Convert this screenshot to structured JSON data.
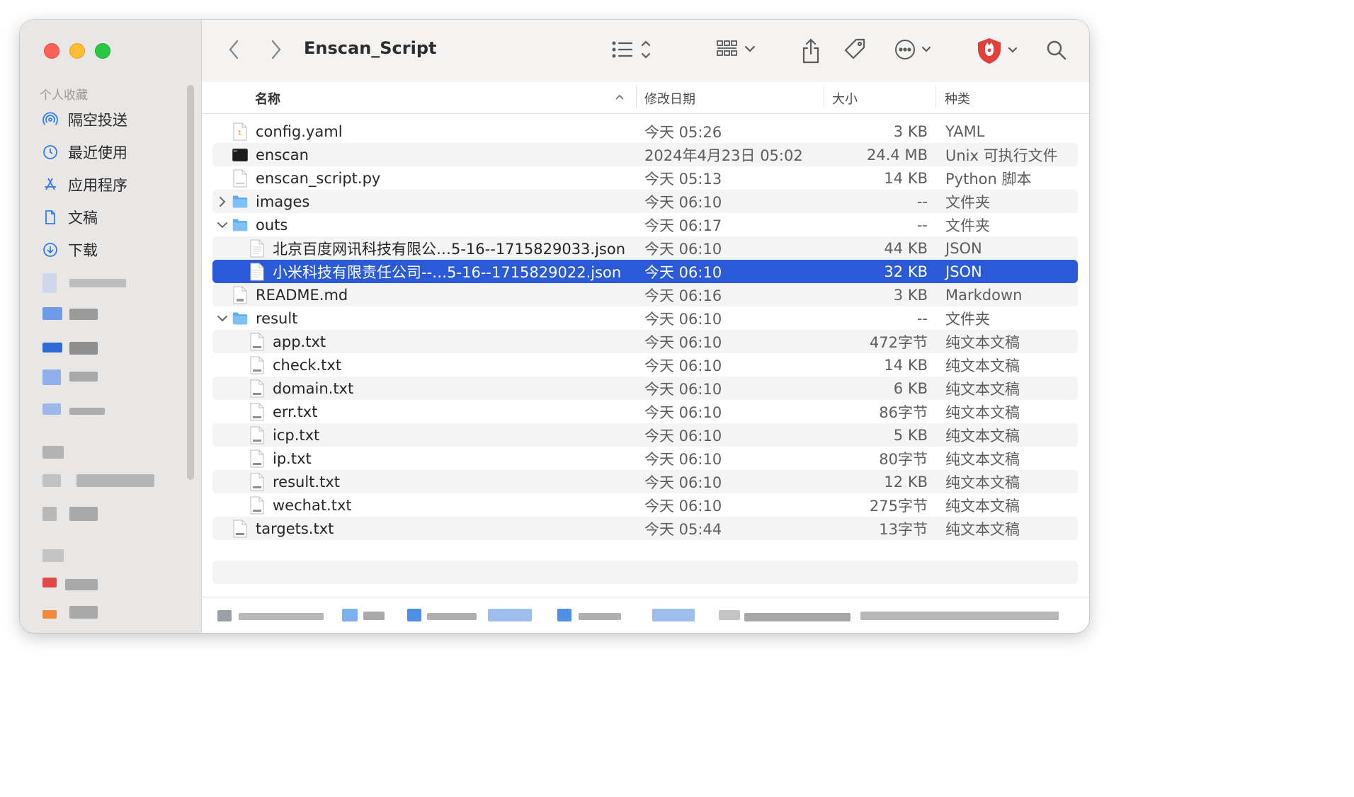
{
  "window": {
    "title": "Enscan_Script"
  },
  "sidebar": {
    "section_label": "个人收藏",
    "items": [
      {
        "label": "隔空投送",
        "icon": "airdrop-icon"
      },
      {
        "label": "最近使用",
        "icon": "clock-icon"
      },
      {
        "label": "应用程序",
        "icon": "applications-icon"
      },
      {
        "label": "文稿",
        "icon": "document-icon"
      },
      {
        "label": "下载",
        "icon": "download-icon"
      }
    ]
  },
  "columns": {
    "name": "名称",
    "date": "修改日期",
    "size": "大小",
    "kind": "种类"
  },
  "files": [
    {
      "name": "config.yaml",
      "date": "今天 05:26",
      "size": "3 KB",
      "kind": "YAML",
      "icon": "yaml-file-icon"
    },
    {
      "name": "enscan",
      "date": "2024年4月23日 05:02",
      "size": "24.4 MB",
      "kind": "Unix 可执行文件",
      "icon": "executable-icon"
    },
    {
      "name": "enscan_script.py",
      "date": "今天 05:13",
      "size": "14 KB",
      "kind": "Python 脚本",
      "icon": "python-file-icon"
    },
    {
      "name": "images",
      "date": "今天 06:10",
      "size": "--",
      "kind": "文件夹",
      "icon": "folder-icon",
      "disclosure": "collapsed"
    },
    {
      "name": "outs",
      "date": "今天 06:17",
      "size": "--",
      "kind": "文件夹",
      "icon": "folder-icon",
      "disclosure": "expanded"
    },
    {
      "name": "北京百度网讯科技有限公…5-16--1715829033.json",
      "date": "今天 06:10",
      "size": "44 KB",
      "kind": "JSON",
      "icon": "json-file-icon",
      "indent": 1
    },
    {
      "name": "小米科技有限责任公司--…5-16--1715829022.json",
      "date": "今天 06:10",
      "size": "32 KB",
      "kind": "JSON",
      "icon": "json-file-icon",
      "indent": 1,
      "selected": true
    },
    {
      "name": "README.md",
      "date": "今天 06:16",
      "size": "3 KB",
      "kind": "Markdown",
      "icon": "markdown-file-icon"
    },
    {
      "name": "result",
      "date": "今天 06:10",
      "size": "--",
      "kind": "文件夹",
      "icon": "folder-icon",
      "disclosure": "expanded"
    },
    {
      "name": "app.txt",
      "date": "今天 06:10",
      "size": "472字节",
      "kind": "纯文本文稿",
      "icon": "txt-file-icon",
      "indent": 1
    },
    {
      "name": "check.txt",
      "date": "今天 06:10",
      "size": "14 KB",
      "kind": "纯文本文稿",
      "icon": "txt-file-icon",
      "indent": 1
    },
    {
      "name": "domain.txt",
      "date": "今天 06:10",
      "size": "6 KB",
      "kind": "纯文本文稿",
      "icon": "txt-file-icon",
      "indent": 1
    },
    {
      "name": "err.txt",
      "date": "今天 06:10",
      "size": "86字节",
      "kind": "纯文本文稿",
      "icon": "txt-file-icon",
      "indent": 1
    },
    {
      "name": "icp.txt",
      "date": "今天 06:10",
      "size": "5 KB",
      "kind": "纯文本文稿",
      "icon": "txt-file-icon",
      "indent": 1
    },
    {
      "name": "ip.txt",
      "date": "今天 06:10",
      "size": "80字节",
      "kind": "纯文本文稿",
      "icon": "txt-file-icon",
      "indent": 1
    },
    {
      "name": "result.txt",
      "date": "今天 06:10",
      "size": "12 KB",
      "kind": "纯文本文稿",
      "icon": "txt-file-icon",
      "indent": 1
    },
    {
      "name": "wechat.txt",
      "date": "今天 06:10",
      "size": "275字节",
      "kind": "纯文本文稿",
      "icon": "txt-file-icon",
      "indent": 1
    },
    {
      "name": "targets.txt",
      "date": "今天 05:44",
      "size": "13字节",
      "kind": "纯文本文稿",
      "icon": "txt-file-icon"
    }
  ],
  "colors": {
    "selection": "#2a5ad7",
    "accent": "#2f7cf6"
  }
}
